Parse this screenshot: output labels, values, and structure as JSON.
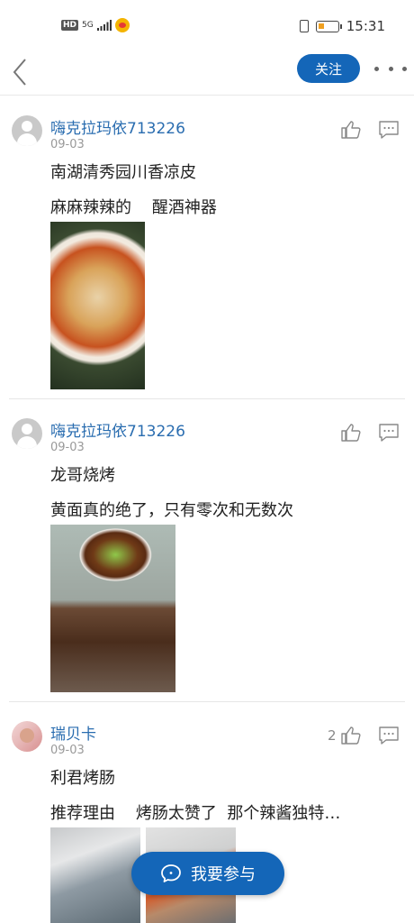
{
  "status_bar": {
    "hd": "HD",
    "network": "5G",
    "time": "15:31"
  },
  "nav": {
    "follow_label": "关注"
  },
  "comments": [
    {
      "username": "嗨克拉玛依713226",
      "date": "09-03",
      "title": "南湖清秀园川香凉皮",
      "text": "麻麻辣辣的    醒酒神器",
      "like_count": ""
    },
    {
      "username": "嗨克拉玛依713226",
      "date": "09-03",
      "title": "龙哥烧烤",
      "text": "黄面真的绝了，只有零次和无数次",
      "like_count": ""
    },
    {
      "username": "瑞贝卡",
      "date": "09-03",
      "title": "利君烤肠",
      "text": "推荐理由    烤肠太赞了  那个辣酱独特…",
      "like_count": "2"
    }
  ],
  "join_button": {
    "label": "我要参与"
  },
  "colors": {
    "accent": "#1466b8",
    "username": "#2a6db0"
  }
}
